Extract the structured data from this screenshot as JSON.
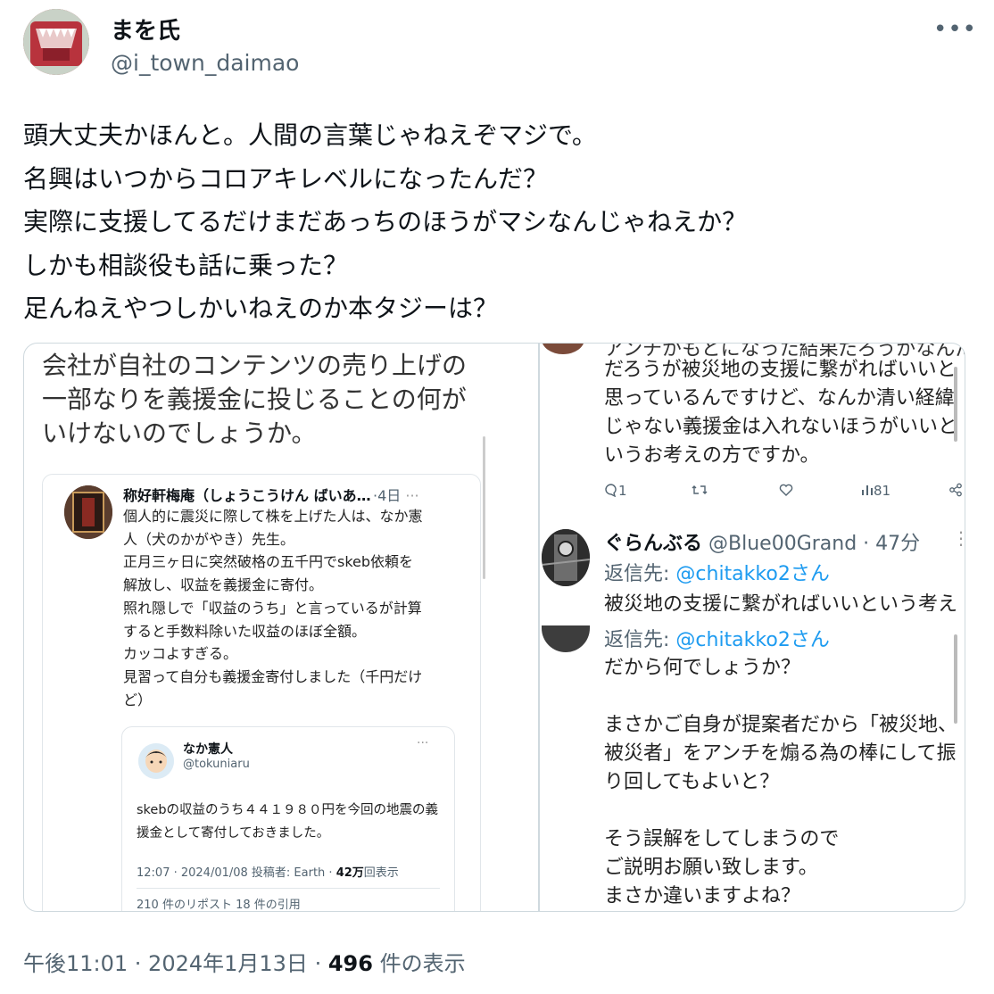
{
  "author": {
    "name": "まを氏",
    "handle": "@i_town_daimao"
  },
  "menu_icon": "more-horizontal-icon",
  "tweet_lines": [
    "頭大丈夫かほんと。人間の言葉じゃねえぞマジで。",
    "名興はいつからコロアキレベルになったんだ？",
    "実際に支援してるだけまだあっちのほうがマシなんじゃねえか？",
    "しかも相談役も話に乗った？",
    "足んねえやつしかいねえのか本タジーは？"
  ],
  "left_image": {
    "title": "会社が自社のコンテンツの売り上げの一部なりを義援金に投じることの何がいけないのでしょうか。",
    "card": {
      "name": "称好軒梅庵（しょうこうけん ばいあ…",
      "time": "·4日",
      "dots": "···",
      "body_lines": [
        "個人的に震災に際して株を上げた人は、なか憲",
        "人（犬のかがやき）先生。",
        "正月三ヶ日に突然破格の五千円でskeb依頼を",
        "解放し、収益を義援金に寄付。",
        "照れ隠しで「収益のうち」と言っているが計算",
        "すると手数料除いた収益のほぼ全額。",
        "カッコよすぎる。",
        "見習って自分も義援金寄付しました（千円だけ",
        "ど）"
      ],
      "quote": {
        "name": "なか憲人",
        "handle": "@tokuniaru",
        "dots": "···",
        "body": "skebの収益のうち４４１９８０円を今回の地震の義援金として寄付しておきました。",
        "meta_prefix": "12:07 · 2024/01/08 投稿者: Earth · ",
        "meta_views": "42万",
        "meta_suffix": "回表示",
        "cut_text": "210 件のリポスト 18 件の引用"
      }
    }
  },
  "right_image": {
    "cut_line": "アンチがもとになった結果だろうがなんだ",
    "body_lines": [
      "だろうが被災地の支援に繋がればいいと",
      "思っているんですけど、なんか清い経緯",
      "じゃない義援金は入れないほうがいいと",
      "いうお考えの方ですか。"
    ],
    "actions": {
      "reply_count": "1",
      "views": "81"
    },
    "reply_user": {
      "name": "ぐらんぶる",
      "meta": "@Blue00Grand · 47分",
      "dots": "⋮"
    },
    "reply_to_label": "返信先: ",
    "reply_to_mention": "@chitakko2さん",
    "reply_body": "被災地の支援に繋がればいいという考え",
    "body2_lines": [
      "だから何でしょうか？",
      "",
      "まさかご自身が提案者だから「被災地、",
      "被災者」をアンチを煽る為の棒にして振",
      "り回してもよいと？",
      "",
      "そう誤解をしてしまうので",
      "ご説明お願い致します。",
      "まさか違いますよね？"
    ]
  },
  "footer": {
    "time": "午後11:01 · 2024年1月13日 · ",
    "views_count": "496",
    "views_label": " 件の表示"
  }
}
